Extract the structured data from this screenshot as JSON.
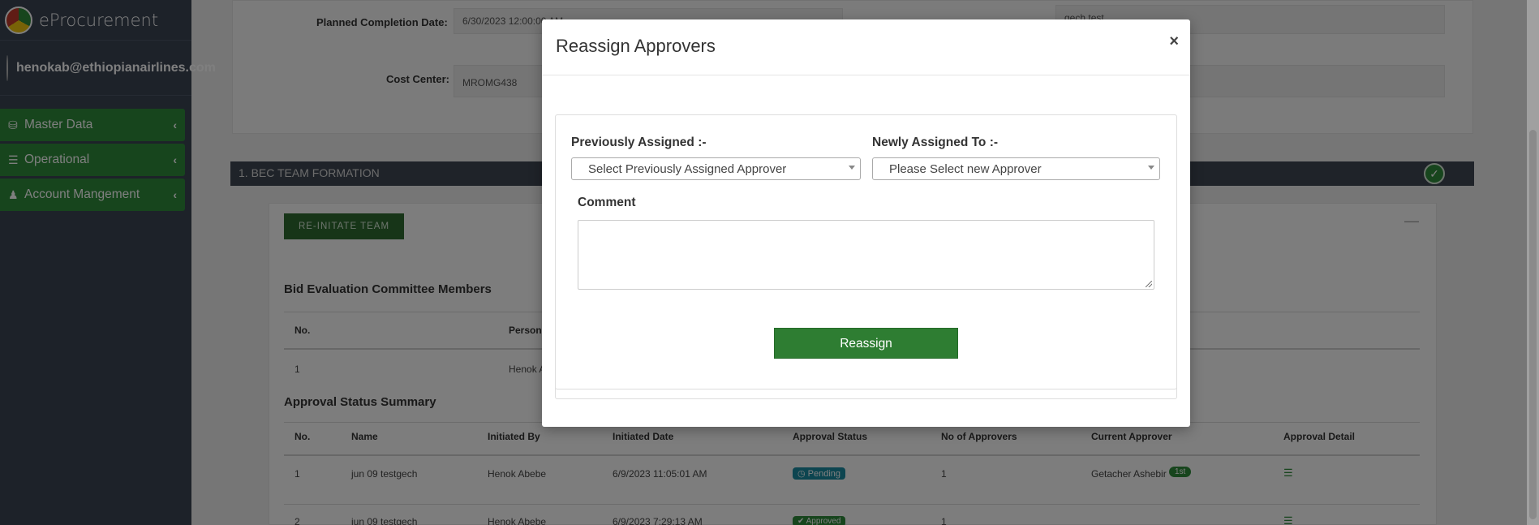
{
  "sidebar": {
    "brand": "eProcurement",
    "user": "henokab@ethiopianairlines.com",
    "items": [
      {
        "label": "Master Data",
        "icon": "database-icon"
      },
      {
        "label": "Operational",
        "icon": "list-icon"
      },
      {
        "label": "Account Mangement",
        "icon": "users-icon"
      }
    ]
  },
  "background": {
    "planned_completion_label": "Planned Completion Date:",
    "planned_completion_value": "6/30/2023 12:00:00 AM",
    "cost_center_label": "Cost Center:",
    "cost_center_value": "MROMG438",
    "right_field_value": "gech test",
    "section_title": "1. BEC TEAM FORMATION",
    "reinitiate_label": "RE-INITATE TEAM",
    "committee_heading": "Bid Evaluation Committee Members",
    "committee_headers": [
      "No.",
      "Person"
    ],
    "committee_rows": [
      [
        "1",
        "Henok A"
      ]
    ],
    "approval_heading": "Approval Status Summary",
    "approval_headers": [
      "No.",
      "Name",
      "Initiated By",
      "Initiated Date",
      "Approval Status",
      "No of Approvers",
      "Current Approver",
      "Approval Detail"
    ],
    "approval_rows": [
      {
        "no": "1",
        "name": "jun 09 testgech",
        "initiated_by": "Henok Abebe",
        "date": "6/9/2023 11:05:01 AM",
        "status": "Pending",
        "approvers": "1",
        "current": "Getacher Ashebir",
        "step": "1st"
      },
      {
        "no": "2",
        "name": "jun 09 testgech",
        "initiated_by": "Henok Abebe",
        "date": "6/9/2023 7:29:13 AM",
        "status": "Approved",
        "approvers": "1",
        "current": "",
        "step": ""
      }
    ]
  },
  "modal": {
    "title": "Reassign Approvers",
    "close": "×",
    "previously_label": "Previously Assigned :-",
    "previously_placeholder": "Select Previously Assigned Approver",
    "newly_label": "Newly Assigned To :-",
    "newly_placeholder": "Please Select new Approver",
    "comment_label": "Comment",
    "comment_value": "",
    "submit_label": "Reassign"
  },
  "colors": {
    "sidebar_bg": "#3a4452",
    "accent_green": "#2e8b3a",
    "section_bar": "#3e4753",
    "pending": "#1a8aa0"
  }
}
